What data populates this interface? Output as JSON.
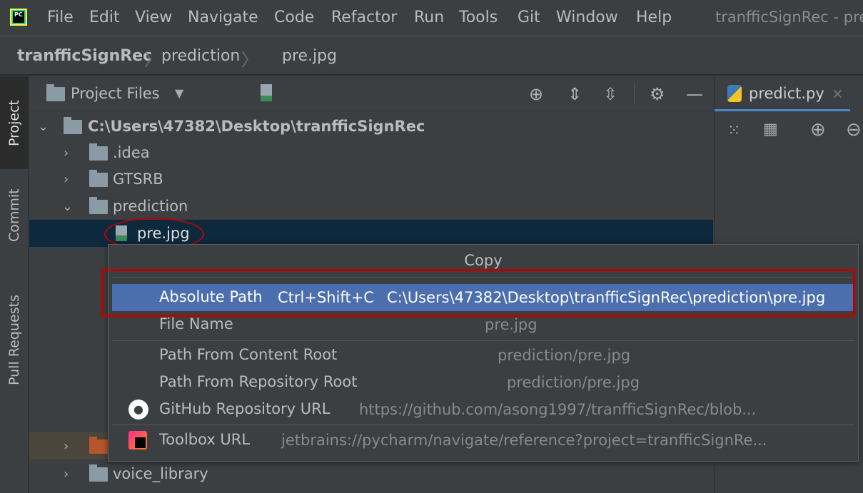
{
  "menubar": {
    "items": [
      "File",
      "Edit",
      "View",
      "Navigate",
      "Code",
      "Refactor",
      "Run",
      "Tools",
      "Git",
      "Window",
      "Help"
    ],
    "title": "tranfficSignRec - pre"
  },
  "breadcrumb": [
    "tranfficSignRec",
    "prediction",
    "pre.jpg"
  ],
  "toolstrip": {
    "project": "Project",
    "commit": "Commit",
    "pull_requests": "Pull Requests"
  },
  "project_panel": {
    "view": "Project Files"
  },
  "tree": {
    "root": "C:\\Users\\47382\\Desktop\\tranfficSignRec",
    "items": [
      ".idea",
      "GTSRB",
      "prediction",
      "pre.jpg",
      "voice_library"
    ]
  },
  "editor": {
    "tab": "predict.py"
  },
  "popup": {
    "title": "Copy",
    "items": [
      {
        "label": "Absolute Path",
        "shortcut": "Ctrl+Shift+C",
        "value": "C:\\Users\\47382\\Desktop\\tranfficSignRec\\prediction\\pre.jpg"
      },
      {
        "label": "File Name",
        "value": "pre.jpg"
      },
      {
        "label": "Path From Content Root",
        "value": "prediction/pre.jpg"
      },
      {
        "label": "Path From Repository Root",
        "value": "prediction/pre.jpg"
      },
      {
        "label": "GitHub Repository URL",
        "value": "https://github.com/asong1997/tranfficSignRec/blob..."
      },
      {
        "label": "Toolbox URL",
        "value": "jetbrains://pycharm/navigate/reference?project=tranfficSignRe..."
      }
    ]
  },
  "colors": {
    "selection": "#4b6eaf",
    "annotation": "#c00000",
    "tree_selection": "#0d293e"
  }
}
